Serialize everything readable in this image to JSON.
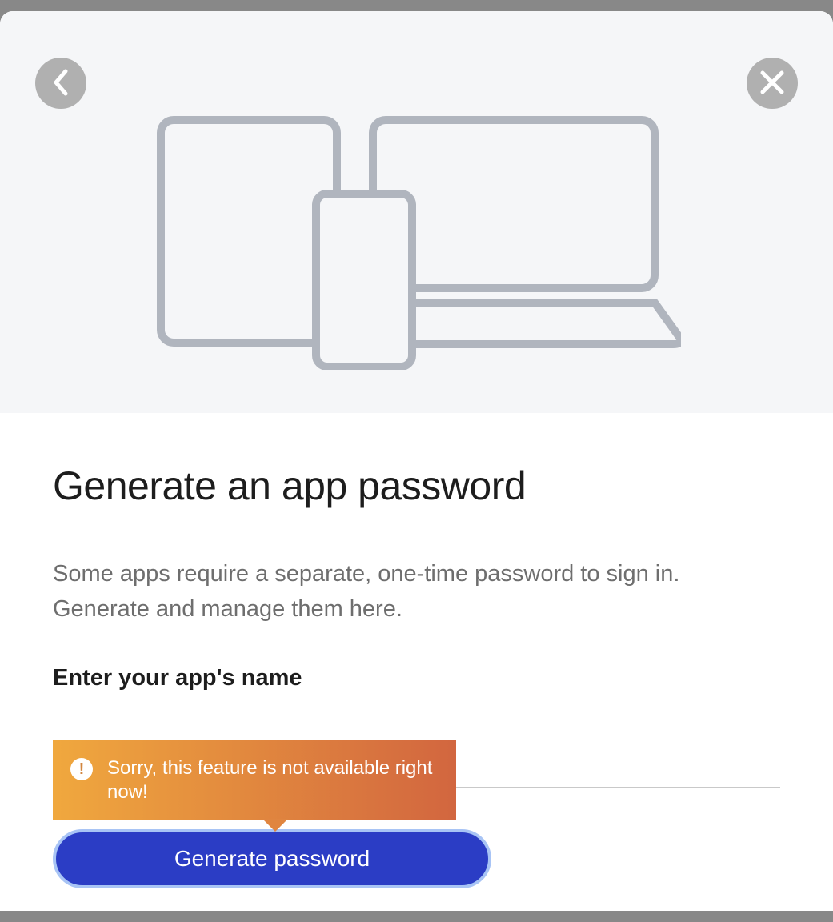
{
  "header": {
    "icons": {
      "back": "chevron-left-icon",
      "close": "close-icon",
      "devices": "devices-illustration"
    }
  },
  "content": {
    "title": "Generate an app password",
    "description": "Some apps require a separate, one-time password to sign in. Generate and manage them here.",
    "input_label": "Enter your app's name",
    "input_value": ""
  },
  "tooltip": {
    "message": "Sorry, this feature is not available right now!",
    "icon": "alert-icon"
  },
  "button": {
    "label": "Generate password"
  },
  "colors": {
    "primary_button": "#2b3dc5",
    "button_border": "#a8c4f5",
    "tooltip_gradient_start": "#f0a83e",
    "tooltip_gradient_end": "#d2663f",
    "text_primary": "#1d1d1d",
    "text_secondary": "#6e6e6e",
    "illustration": "#b0b5be"
  }
}
